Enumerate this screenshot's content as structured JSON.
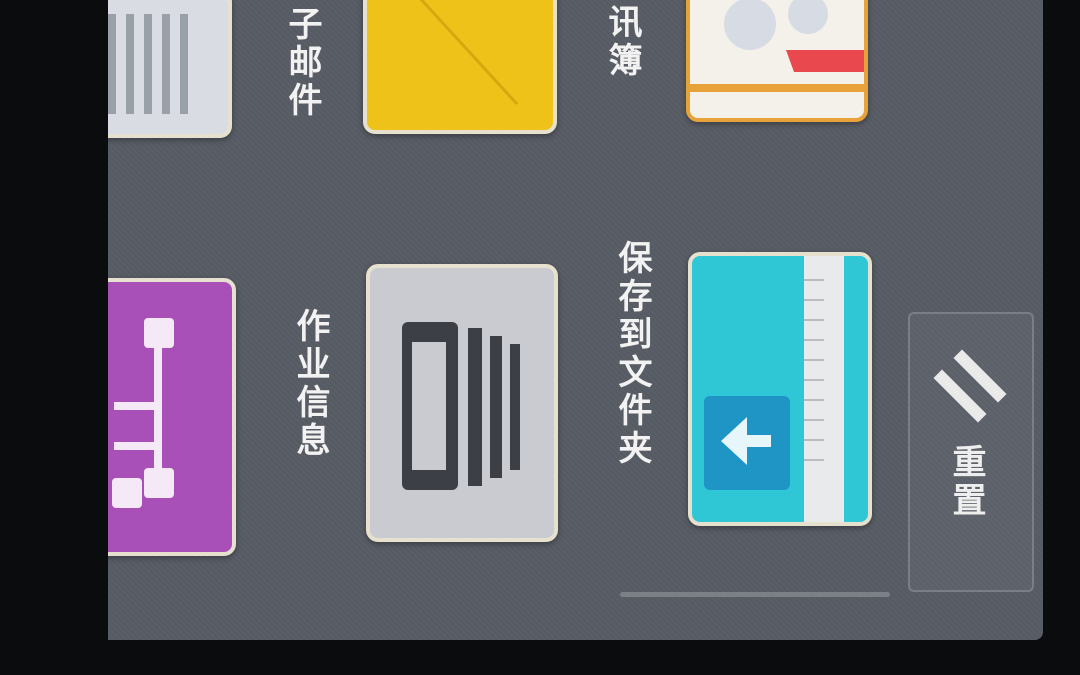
{
  "tiles": {
    "email": {
      "label": "子邮件"
    },
    "address_book": {
      "label": "讯簿"
    },
    "job_info": {
      "label": "作业信息"
    },
    "save_to_folder": {
      "label": "保存到文件夹"
    }
  },
  "reset_button": {
    "label": "重置",
    "icon": "double-chevron-icon"
  },
  "colors": {
    "screen_bg": "#5a5e66",
    "yellow_tile": "#efc21a",
    "purple_tile": "#a94fb8",
    "teal_tile": "#2fc6d6",
    "grey_tile": "#c9cbd0",
    "tile_border": "#e6e0cf"
  }
}
